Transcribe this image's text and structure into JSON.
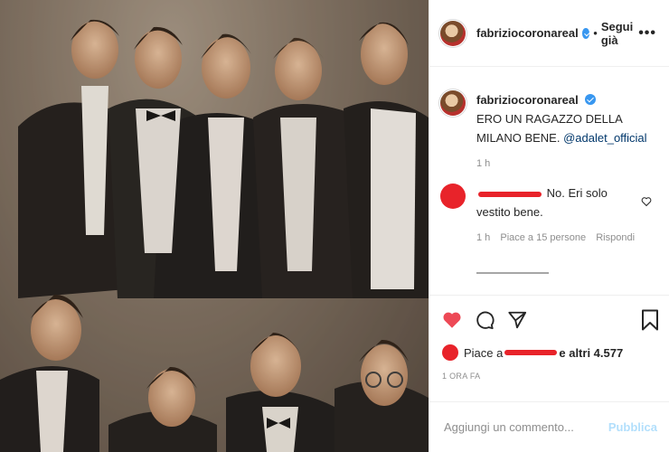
{
  "post": {
    "photo_description_icon": "group-photo",
    "username": "fabriziocoronareal",
    "follow_separator": "•",
    "follow_label": "Segui già",
    "more_label": "•••"
  },
  "caption": {
    "username": "fabriziocoronareal",
    "text": "ERO UN RAGAZZO DELLA MILANO BENE.",
    "mention": "@adalet_official",
    "time": "1 h"
  },
  "comments": [
    {
      "text": "No. Eri solo vestito bene.",
      "time": "1 h",
      "likes": "Piace a 15 persone",
      "reply": "Rispondi"
    }
  ],
  "actions": {
    "likes_prefix": "Piace a",
    "likes_suffix": "e altri 4.577",
    "timestamp": "1 ORA FA"
  },
  "add_comment": {
    "placeholder": "Aggiungi un commento...",
    "publish": "Pubblica"
  },
  "colors": {
    "accent": "#3897f0",
    "like_red": "#ed4956",
    "redaction": "#e8232a"
  }
}
